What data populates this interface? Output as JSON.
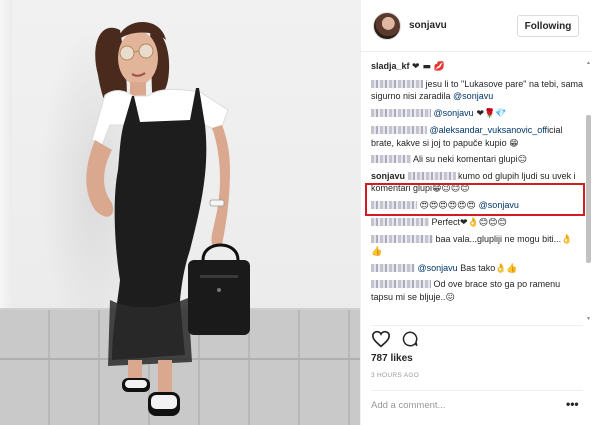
{
  "post": {
    "username": "sonjavu",
    "follow_label": "Following",
    "likes_text": "787 likes",
    "time_text": "3 HOURS AGO",
    "add_comment_placeholder": "Add a comment...",
    "more_label": "•••"
  },
  "comments": [
    {
      "user": "sladja_kf",
      "text": "❤ ▬ 💋"
    },
    {
      "blur_user": true,
      "text": "jesu li to \"Lukasove pare\" na tebi, sama sigurno nisi zaradila ",
      "mention": "@sonjavu"
    },
    {
      "blur_user": true,
      "mention": "@sonjavu",
      "text": " ❤🌹💎"
    },
    {
      "blur_user": true,
      "mention": "@aleksandar_vuksanovic_off",
      "text": "icial brate, kakve si joj to papuče kupio 😁"
    },
    {
      "blur_user": true,
      "text": "Ali su neki komentari glupi😑"
    },
    {
      "user": "sonjavu",
      "blur_prefix": true,
      "text": "kumo od glupih ljudi su uvek i komentari glupi😁😉😊😊"
    },
    {
      "blur_user": true,
      "text": "😍😍😍😍😍😍 ",
      "mention": "@sonjavu"
    },
    {
      "blur_user": true,
      "text": "Perfect❤👌😊😊😊"
    },
    {
      "blur_user": true,
      "text": "baa vala...glupliji ne mogu biti...👌👍"
    },
    {
      "blur_user": true,
      "mention": "@sonjavu",
      "text": " Bas tako👌👍"
    },
    {
      "blur_user": true,
      "text": "Od ove brace sto ga po ramenu tapsu mi se bljuje..😖"
    }
  ],
  "colors": {
    "highlight": "#d31b22",
    "mention": "#003569",
    "muted": "#999999"
  },
  "icons": {
    "like": "heart-icon",
    "comment": "comment-icon",
    "more": "more-options-icon"
  }
}
